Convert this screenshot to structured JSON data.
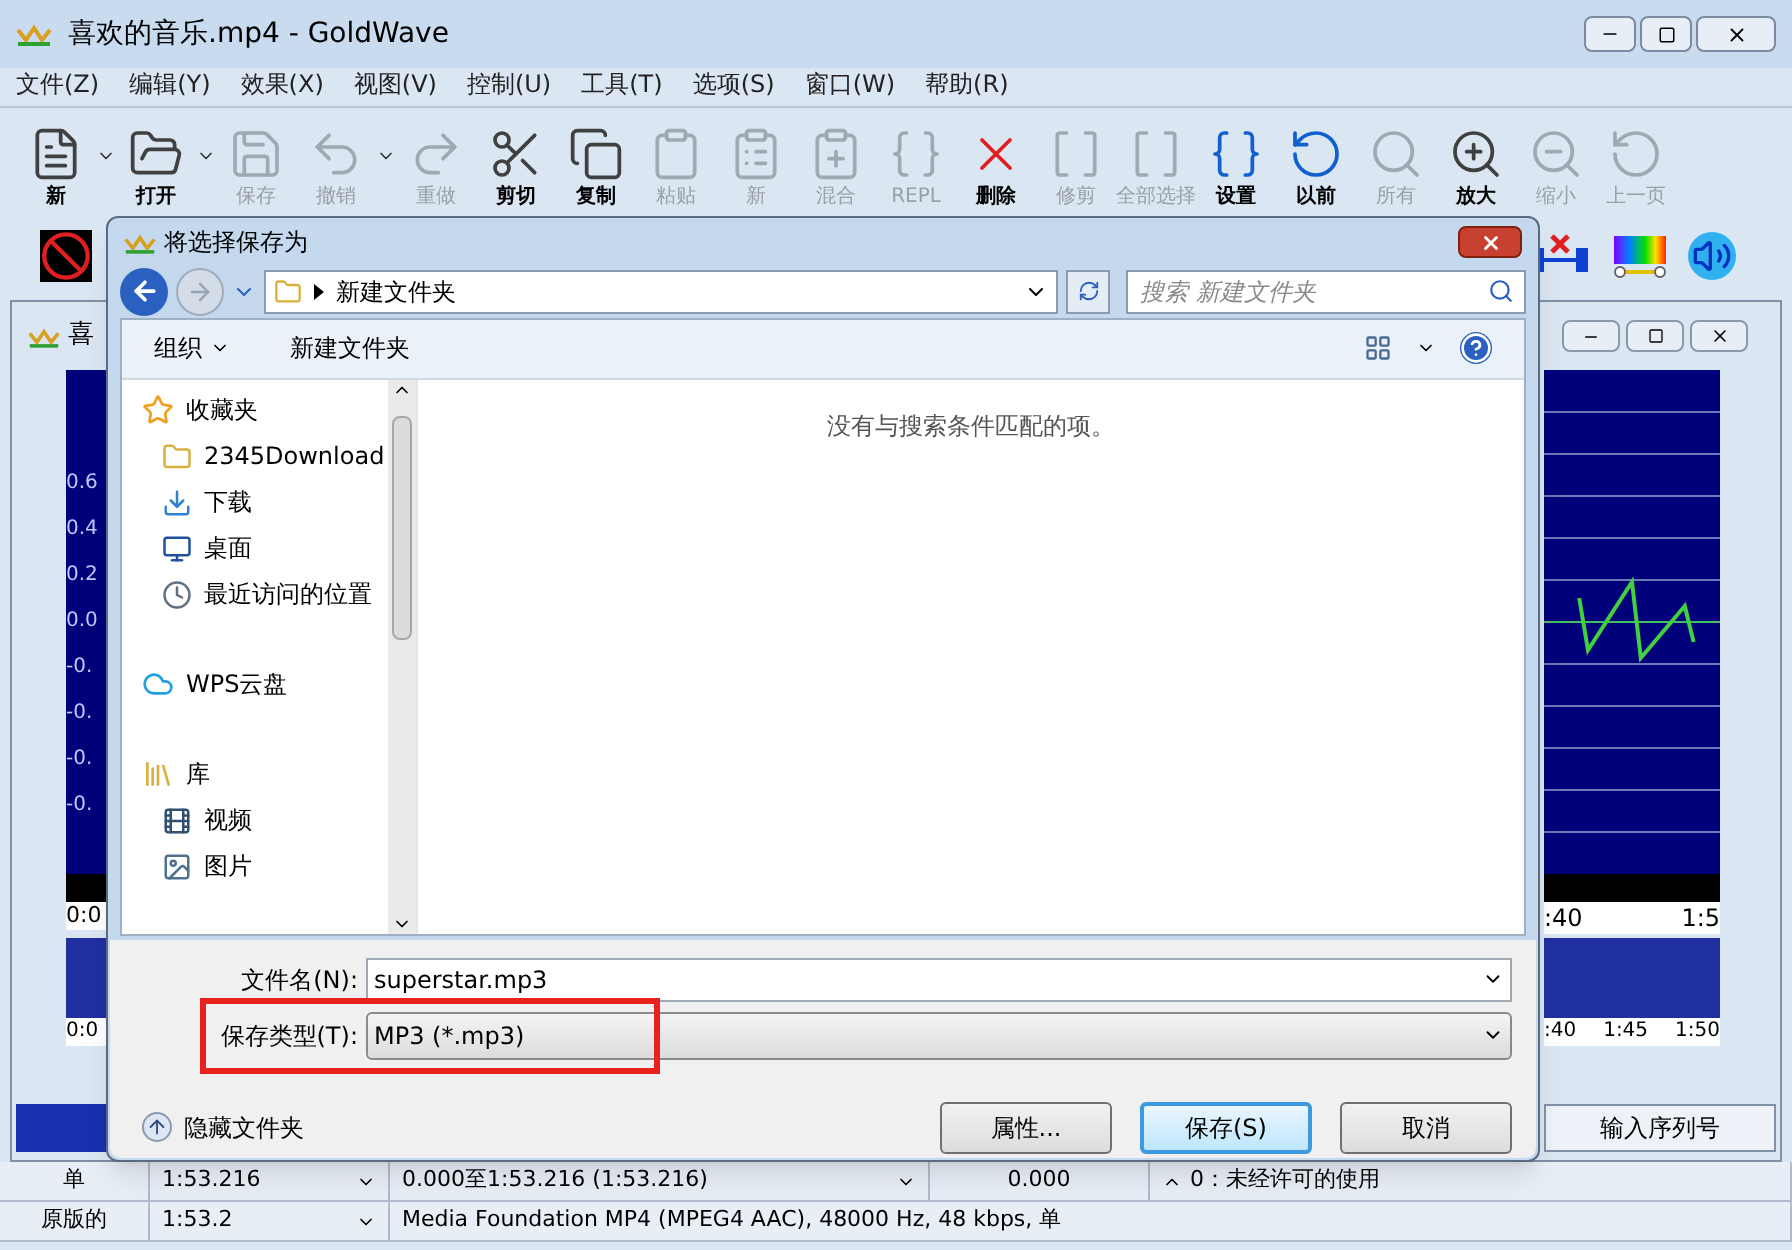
{
  "window": {
    "title": "喜欢的音乐.mp4 - GoldWave"
  },
  "menu": [
    "文件(Z)",
    "编辑(Y)",
    "效果(X)",
    "视图(V)",
    "控制(U)",
    "工具(T)",
    "选项(S)",
    "窗口(W)",
    "帮助(R)"
  ],
  "toolbar": [
    {
      "label": "新",
      "disabled": false,
      "dropdown": true
    },
    {
      "label": "打开",
      "disabled": false,
      "dropdown": true
    },
    {
      "label": "保存",
      "disabled": true,
      "dropdown": false
    },
    {
      "label": "撤销",
      "disabled": true,
      "dropdown": true
    },
    {
      "label": "重做",
      "disabled": true,
      "dropdown": false
    },
    {
      "label": "剪切",
      "disabled": false,
      "dropdown": false
    },
    {
      "label": "复制",
      "disabled": false,
      "dropdown": false
    },
    {
      "label": "粘贴",
      "disabled": true,
      "dropdown": false
    },
    {
      "label": "新",
      "disabled": true,
      "dropdown": false
    },
    {
      "label": "混合",
      "disabled": true,
      "dropdown": false
    },
    {
      "label": "REPL",
      "disabled": true,
      "dropdown": false
    },
    {
      "label": "删除",
      "disabled": false,
      "dropdown": false
    },
    {
      "label": "修剪",
      "disabled": true,
      "dropdown": false
    },
    {
      "label": "全部选择",
      "disabled": true,
      "dropdown": false
    },
    {
      "label": "设置",
      "disabled": false,
      "dropdown": false
    },
    {
      "label": "以前",
      "disabled": false,
      "dropdown": false
    },
    {
      "label": "所有",
      "disabled": true,
      "dropdown": false
    },
    {
      "label": "放大",
      "disabled": false,
      "dropdown": false
    },
    {
      "label": "缩小",
      "disabled": true,
      "dropdown": false
    },
    {
      "label": "上一页",
      "disabled": true,
      "dropdown": false
    }
  ],
  "document": {
    "title": "喜",
    "amplitude_labels": [
      "0.6",
      "0.4",
      "0.2",
      "0.0",
      "-0.",
      "-0.",
      "-0.",
      "-0."
    ],
    "timeline_left": "0:0",
    "timeline_right": [
      ":40",
      "1:5"
    ],
    "overview_left": "0:0",
    "overview_right": [
      ":40",
      "1:45",
      "1:50"
    ],
    "serial_button": "输入序列号"
  },
  "dialog": {
    "title": "将选择保存为",
    "breadcrumb": "新建文件夹",
    "search": {
      "placeholder": "搜索 新建文件夹"
    },
    "toolbar": [
      "组织",
      "新建文件夹"
    ],
    "nav": [
      {
        "kind": "favorites",
        "label": "收藏夹",
        "children": [
          {
            "kind": "folder",
            "label": "2345Download"
          },
          {
            "kind": "download",
            "label": "下载"
          },
          {
            "kind": "desktop",
            "label": "桌面"
          },
          {
            "kind": "recent",
            "label": "最近访问的位置"
          }
        ]
      },
      {
        "kind": "cloud",
        "label": "WPS云盘"
      },
      {
        "kind": "library",
        "label": "库",
        "children": [
          {
            "kind": "video",
            "label": "视频"
          },
          {
            "kind": "picture",
            "label": "图片"
          }
        ]
      }
    ],
    "empty_message": "没有与搜索条件匹配的项。",
    "filename": {
      "label": "文件名(N):",
      "value": "superstar.mp3"
    },
    "filetype": {
      "label": "保存类型(T):",
      "value": "MP3 (*.mp3)",
      "highlighted": true
    },
    "hide_folders": "隐藏文件夹",
    "buttons": [
      {
        "label": "属性...",
        "default": false
      },
      {
        "label": "保存(S)",
        "default": true
      },
      {
        "label": "取消",
        "default": false
      }
    ]
  },
  "status_bar": [
    [
      "单",
      "1:53.216",
      "0.000至1:53.216 (1:53.216)",
      "0.000",
      "0：未经许可的使用"
    ],
    [
      "原版的",
      "1:53.2",
      "Media Foundation MP4 (MPEG4 AAC), 48000 Hz, 48 kbps, 单"
    ]
  ]
}
